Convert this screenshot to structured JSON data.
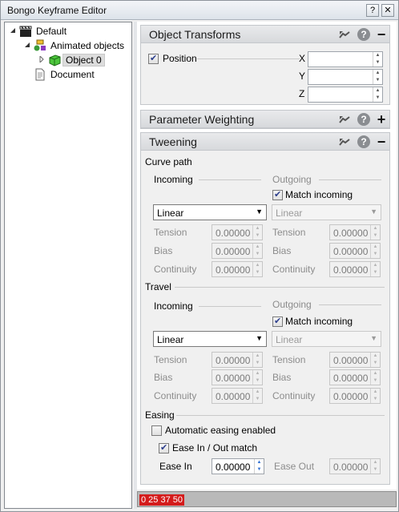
{
  "window": {
    "title": "Bongo Keyframe Editor",
    "help_btn": "?",
    "close_btn": "✕"
  },
  "tree": {
    "items": [
      {
        "label": "Default",
        "icon": "clapperboard-icon"
      },
      {
        "label": "Animated objects",
        "icon": "animated-objects-icon"
      },
      {
        "label": "Object 0",
        "icon": "green-cube-icon"
      },
      {
        "label": "Document",
        "icon": "document-icon"
      }
    ]
  },
  "sections": {
    "transforms": {
      "title": "Object Transforms",
      "position_label": "Position",
      "x_label": "X",
      "y_label": "Y",
      "z_label": "Z",
      "x_value": "",
      "y_value": "",
      "z_value": ""
    },
    "weighting": {
      "title": "Parameter Weighting"
    },
    "tweening": {
      "title": "Tweening",
      "curve_path": {
        "label": "Curve path",
        "incoming_label": "Incoming",
        "outgoing_label": "Outgoing",
        "match_incoming": "Match incoming",
        "incoming_combo": "Linear",
        "outgoing_combo": "Linear",
        "tension_label": "Tension",
        "bias_label": "Bias",
        "continuity_label": "Continuity",
        "in_tension": "0.00000",
        "in_bias": "0.00000",
        "in_continuity": "0.00000",
        "out_tension": "0.00000",
        "out_bias": "0.00000",
        "out_continuity": "0.00000"
      },
      "travel": {
        "label": "Travel",
        "incoming_label": "Incoming",
        "outgoing_label": "Outgoing",
        "match_incoming": "Match incoming",
        "incoming_combo": "Linear",
        "outgoing_combo": "Linear",
        "tension_label": "Tension",
        "bias_label": "Bias",
        "continuity_label": "Continuity",
        "in_tension": "0.00000",
        "in_bias": "0.00000",
        "in_continuity": "0.00000",
        "out_tension": "0.00000",
        "out_bias": "0.00000",
        "out_continuity": "0.00000"
      },
      "easing": {
        "label": "Easing",
        "auto_label": "Automatic easing enabled",
        "match_label": "Ease In / Out match",
        "ease_in_label": "Ease In",
        "ease_in_value": "0.00000",
        "ease_out_label": "Ease Out",
        "ease_out_value": "0.00000"
      }
    }
  },
  "status": {
    "badge": "0 25 37 50"
  },
  "colors": {
    "badge": "#d41b1b",
    "header": "#d7d9dc",
    "checkmark": "#2c3e8c"
  }
}
